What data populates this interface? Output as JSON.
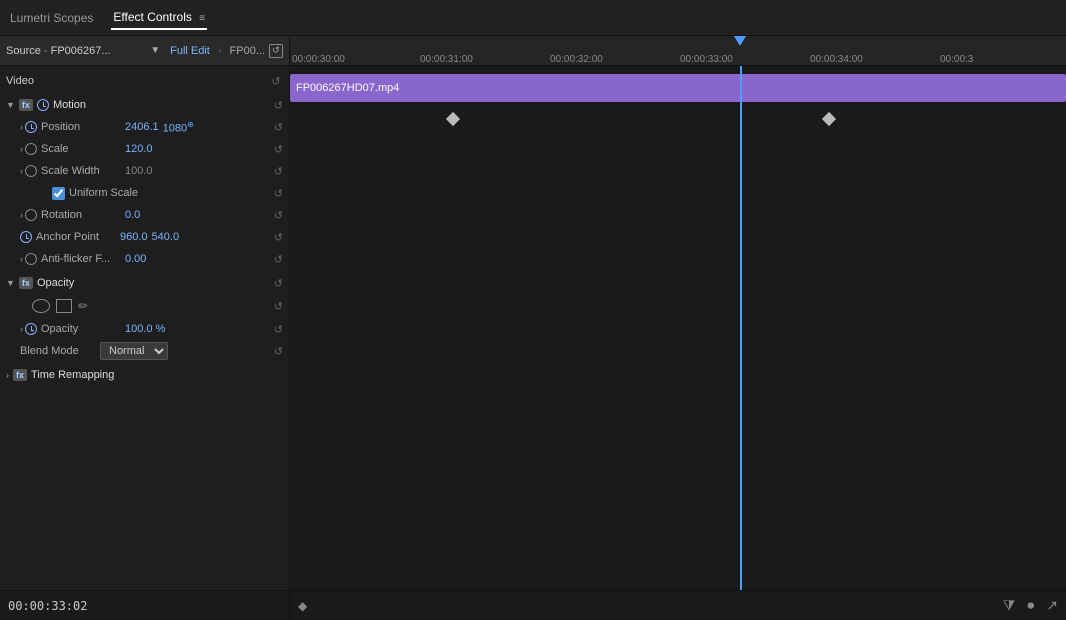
{
  "tabs": [
    {
      "id": "lumetri",
      "label": "Lumetri Scopes",
      "active": false
    },
    {
      "id": "effect-controls",
      "label": "Effect Controls",
      "active": true
    }
  ],
  "tab_menu_icon": "≡",
  "source": {
    "label": "Source · FP006267...",
    "dropdown_icon": "▼",
    "edit_label": "Full Edit",
    "separator": "·",
    "fp_label": "FP00..."
  },
  "video_label": "Video",
  "effects": {
    "motion": {
      "name": "Motion",
      "params": [
        {
          "name": "Position",
          "value": "2406.1",
          "value2": "1080",
          "has_keyframe": true,
          "color": "blue"
        },
        {
          "name": "Scale",
          "value": "120.0",
          "has_keyframe": false
        },
        {
          "name": "Scale Width",
          "value": "100.0",
          "has_keyframe": false,
          "color": "gray"
        },
        {
          "name": "Uniform Scale",
          "type": "checkbox",
          "checked": true
        },
        {
          "name": "Rotation",
          "value": "0.0",
          "has_keyframe": false
        },
        {
          "name": "Anchor Point",
          "value": "960.0",
          "value2": "540.0",
          "has_keyframe": false
        },
        {
          "name": "Anti-flicker F...",
          "value": "0.00",
          "has_keyframe": false
        }
      ]
    },
    "opacity": {
      "name": "Opacity",
      "params": [
        {
          "name": "Opacity",
          "value": "100.0 %",
          "has_keyframe": true
        },
        {
          "name": "Blend Mode",
          "type": "select",
          "value": "Normal"
        }
      ]
    },
    "time_remapping": {
      "name": "Time Remapping"
    }
  },
  "timeline": {
    "clip_name": "FP006267HD07.mp4",
    "timecodes": [
      "00:00:30:00",
      "00:00:31:00",
      "00:00:32:00",
      "00:00:33:00",
      "00:00:34:00",
      "00:00:3"
    ],
    "playhead_position": "00:00:33:02",
    "playhead_percent": 64
  },
  "status": {
    "timecode": "00:00:33:02"
  },
  "bottom_controls": {
    "go_to_start": "⏮",
    "filter_icon": "⧩",
    "pin_icon": "📌",
    "export_icon": "↗"
  }
}
